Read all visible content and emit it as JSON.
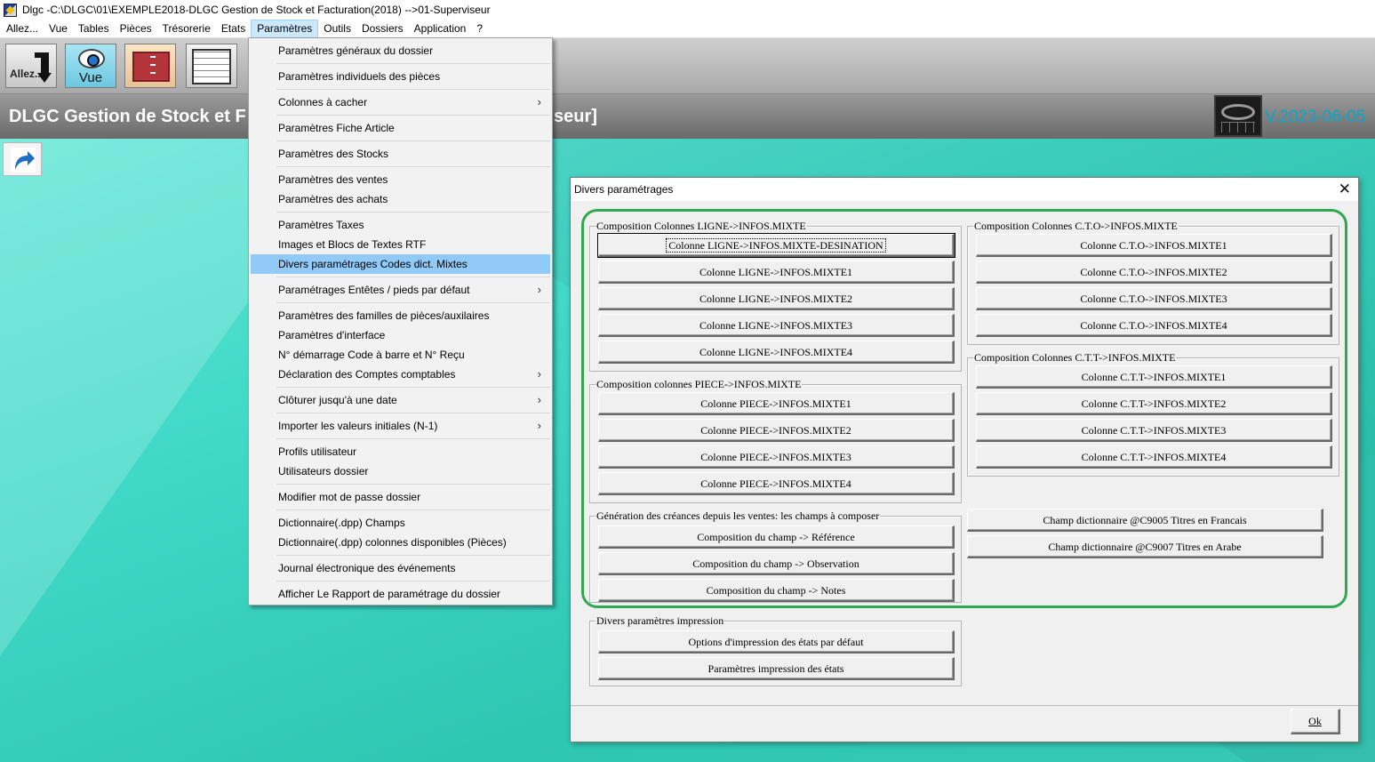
{
  "window": {
    "title": "Dlgc -C:\\DLGC\\01\\EXEMPLE2018-DLGC Gestion de Stock et Facturation(2018) -->01-Superviseur"
  },
  "menubar": [
    "Allez...",
    "Vue",
    "Tables",
    "Pièces",
    "Trésorerie",
    "Etats",
    "Paramètres",
    "Outils",
    "Dossiers",
    "Application",
    "?"
  ],
  "toolbar": {
    "allez_label": "Allez...",
    "vue_label": "Vue"
  },
  "banner": {
    "title": "DLGC Gestion de Stock et F",
    "title_tail": "seur]",
    "version": "V.2023-06-05"
  },
  "dropdown": {
    "items": [
      {
        "label": "Paramètres généraux du dossier",
        "submenu": false
      },
      {
        "label": "Paramètres individuels des pièces",
        "submenu": false
      },
      {
        "label": "Colonnes à cacher",
        "submenu": true
      },
      {
        "label": "Paramètres Fiche Article",
        "submenu": false
      },
      {
        "label": "Paramètres des Stocks",
        "submenu": false
      },
      {
        "label": "Paramètres des ventes",
        "submenu": false
      },
      {
        "label": "Paramètres des achats",
        "submenu": false
      },
      {
        "label": "Paramètres Taxes",
        "submenu": false
      },
      {
        "label": "Images et Blocs de Textes RTF",
        "submenu": false
      },
      {
        "label": "Divers paramétrages Codes dict. Mixtes",
        "submenu": false,
        "highlighted": true
      },
      {
        "label": "Paramétrages Entêtes / pieds par défaut",
        "submenu": true
      },
      {
        "label": "Paramètres des familles de pièces/auxilaires",
        "submenu": false
      },
      {
        "label": "Paramètres d'interface",
        "submenu": false
      },
      {
        "label": "N° démarrage Code à barre et N° Reçu",
        "submenu": false
      },
      {
        "label": "Déclaration des Comptes comptables",
        "submenu": true
      },
      {
        "label": "Clôturer jusqu'à une date",
        "submenu": true
      },
      {
        "label": "Importer les valeurs initiales (N-1)",
        "submenu": true
      },
      {
        "label": "Profils utilisateur",
        "submenu": false
      },
      {
        "label": "Utilisateurs dossier",
        "submenu": false
      },
      {
        "label": "Modifier mot de passe dossier",
        "submenu": false
      },
      {
        "label": "Dictionnaire(.dpp) Champs",
        "submenu": false
      },
      {
        "label": "Dictionnaire(.dpp) colonnes disponibles (Pièces)",
        "submenu": false
      },
      {
        "label": "Journal électronique des événements",
        "submenu": false
      },
      {
        "label": "Afficher Le Rapport de paramétrage du dossier",
        "submenu": false
      }
    ],
    "submenu_glyph": "›"
  },
  "dialog": {
    "title": "Divers paramétrages",
    "close_glyph": "✕",
    "groups": {
      "ligne": {
        "label": "Composition Colonnes LIGNE->INFOS.MIXTE",
        "buttons": [
          "Colonne LIGNE->INFOS.MIXTE-DESINATION",
          "Colonne LIGNE->INFOS.MIXTE1",
          "Colonne LIGNE->INFOS.MIXTE2",
          "Colonne LIGNE->INFOS.MIXTE3",
          "Colonne LIGNE->INFOS.MIXTE4"
        ]
      },
      "piece": {
        "label": "Composition colonnes PIECE->INFOS.MIXTE",
        "buttons": [
          "Colonne PIECE->INFOS.MIXTE1",
          "Colonne PIECE->INFOS.MIXTE2",
          "Colonne PIECE->INFOS.MIXTE3",
          "Colonne PIECE->INFOS.MIXTE4"
        ]
      },
      "generation": {
        "label": "Génération des créances depuis les ventes: les champs à composer",
        "buttons": [
          "Composition du champ -> Référence",
          "Composition du champ -> Observation",
          "Composition du champ -> Notes"
        ]
      },
      "cto": {
        "label": "Composition Colonnes C.T.O->INFOS.MIXTE",
        "buttons": [
          "Colonne C.T.O->INFOS.MIXTE1",
          "Colonne C.T.O->INFOS.MIXTE2",
          "Colonne C.T.O->INFOS.MIXTE3",
          "Colonne C.T.O->INFOS.MIXTE4"
        ]
      },
      "ctt": {
        "label": "Composition Colonnes C.T.T->INFOS.MIXTE",
        "buttons": [
          "Colonne C.T.T->INFOS.MIXTE1",
          "Colonne C.T.T->INFOS.MIXTE2",
          "Colonne C.T.T->INFOS.MIXTE3",
          "Colonne C.T.T->INFOS.MIXTE4"
        ]
      },
      "impression": {
        "label": "Divers paramètres impression",
        "buttons": [
          "Options d'impression des états par défaut",
          "Paramètres impression des états"
        ]
      }
    },
    "dictionary_buttons": [
      "Champ dictionnaire @C9005 Titres en Francais",
      "Champ dictionnaire  @C9007 Titres en Arabe"
    ],
    "ok_label": "Ok"
  },
  "colors": {
    "highlight": "#91c9f7",
    "annotation_ring": "#2fa84f",
    "version_text": "#0aa8c8"
  }
}
